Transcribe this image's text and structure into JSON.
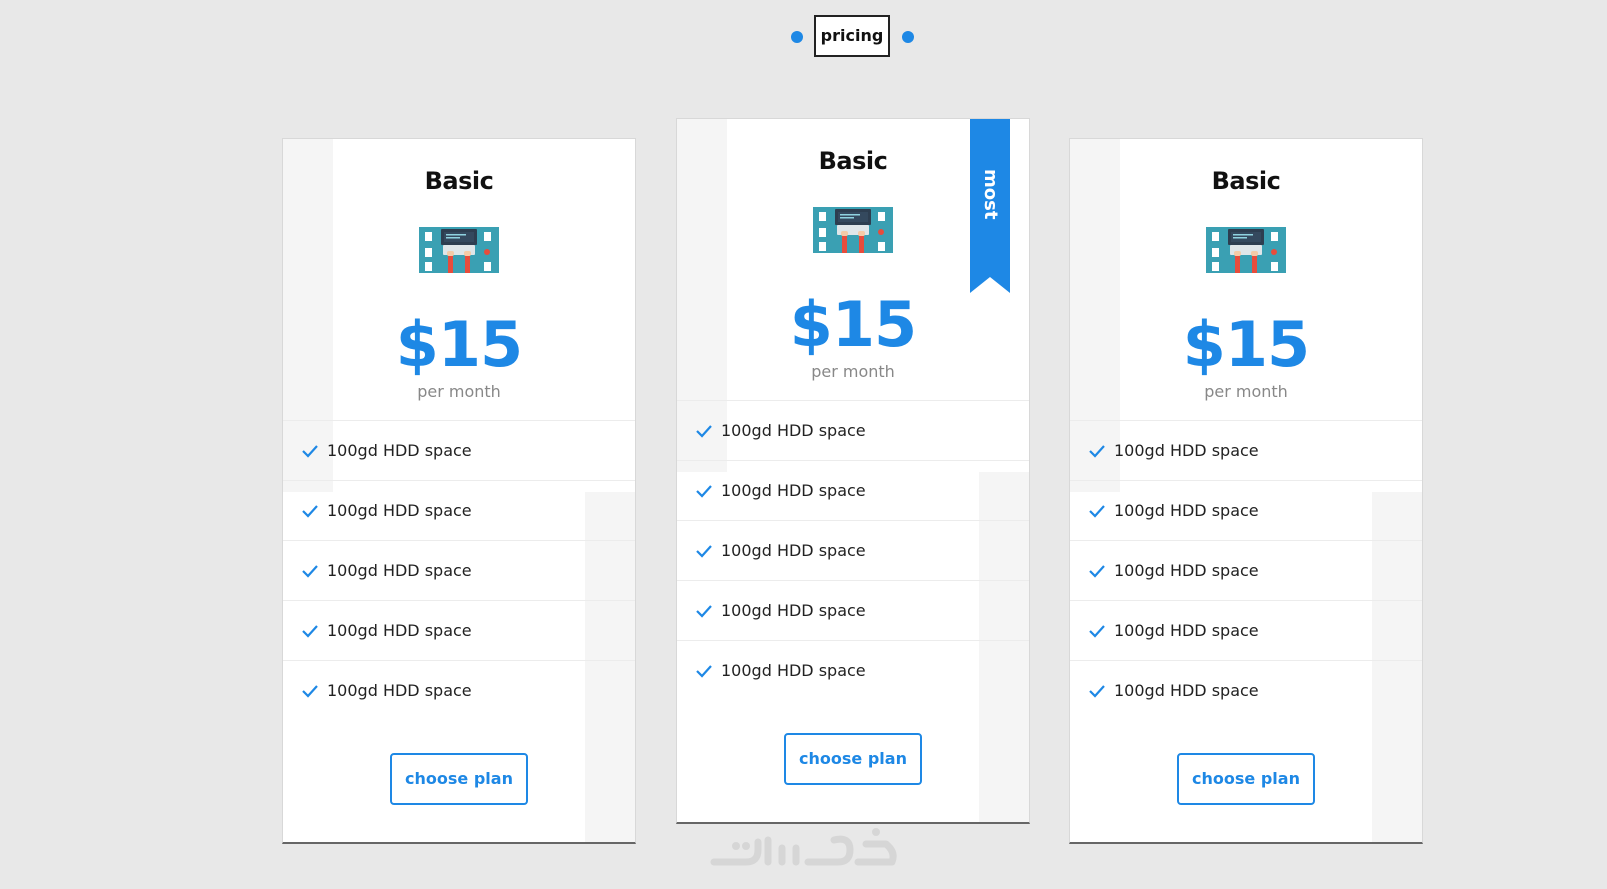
{
  "header": {
    "title": "pricing",
    "accent": "#1e88e5"
  },
  "cards": [
    {
      "name": "Basic",
      "price": "$15",
      "period": "per month",
      "features": [
        "100gd HDD space",
        "100gd HDD space",
        "100gd HDD space",
        "100gd HDD space",
        "100gd HDD space"
      ],
      "button": "choose plan",
      "icon": "developer-desk-icon"
    },
    {
      "name": "Basic",
      "price": "$15",
      "period": "per month",
      "features": [
        "100gd HDD space",
        "100gd HDD space",
        "100gd HDD space",
        "100gd HDD space",
        "100gd HDD space"
      ],
      "button": "choose plan",
      "icon": "developer-desk-icon",
      "ribbon": "most popular"
    },
    {
      "name": "Basic",
      "price": "$15",
      "period": "per month",
      "features": [
        "100gd HDD space",
        "100gd HDD space",
        "100gd HDD space",
        "100gd HDD space",
        "100gd HDD space"
      ],
      "button": "choose plan",
      "icon": "developer-desk-icon"
    }
  ],
  "watermark": {
    "icon": "khamsat-logo-icon"
  }
}
